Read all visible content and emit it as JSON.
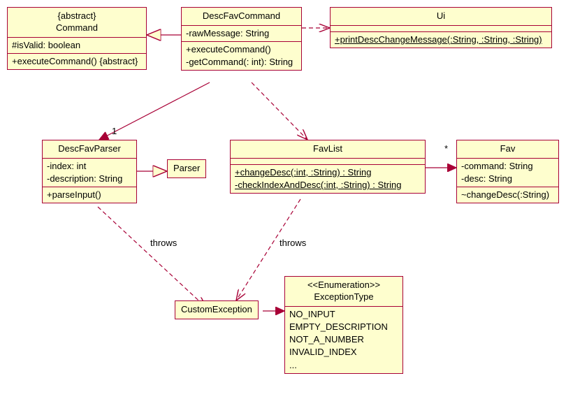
{
  "chart_data": {
    "type": "uml-class-diagram",
    "classes": [
      {
        "name": "Command",
        "stereotype": "{abstract}",
        "attributes": [
          "#isValid: boolean"
        ],
        "operations": [
          "+executeCommand() {abstract}"
        ]
      },
      {
        "name": "DescFavCommand",
        "attributes": [
          "-rawMessage: String"
        ],
        "operations": [
          "+executeCommand()",
          "-getCommand(: int): String"
        ]
      },
      {
        "name": "Ui",
        "operations_static": [
          "+printDescChangeMessage(:String, :String, :String)"
        ]
      },
      {
        "name": "DescFavParser",
        "attributes": [
          "-index: int",
          "-description: String"
        ],
        "operations": [
          "+parseInput()"
        ]
      },
      {
        "name": "Parser"
      },
      {
        "name": "FavList",
        "operations_static": [
          "+changeDesc(:int, :String) : String",
          "-checkIndexAndDesc(:int, :String) : String"
        ]
      },
      {
        "name": "Fav",
        "attributes": [
          "-command: String",
          "-desc: String"
        ],
        "operations": [
          "~changeDesc(:String)"
        ]
      },
      {
        "name": "CustomException"
      },
      {
        "name": "ExceptionType",
        "stereotype": "<<Enumeration>>",
        "literals": [
          "NO_INPUT",
          "EMPTY_DESCRIPTION",
          "NOT_A_NUMBER",
          "INVALID_INDEX",
          "..."
        ]
      }
    ],
    "relationships": [
      {
        "from": "DescFavCommand",
        "to": "Command",
        "type": "generalization"
      },
      {
        "from": "DescFavCommand",
        "to": "Ui",
        "type": "dependency"
      },
      {
        "from": "DescFavCommand",
        "to": "DescFavParser",
        "type": "association",
        "multiplicity_to": "1"
      },
      {
        "from": "DescFavCommand",
        "to": "FavList",
        "type": "dependency"
      },
      {
        "from": "DescFavParser",
        "to": "Parser",
        "type": "generalization"
      },
      {
        "from": "FavList",
        "to": "Fav",
        "type": "association",
        "multiplicity_to": "*"
      },
      {
        "from": "DescFavParser",
        "to": "CustomException",
        "type": "dependency",
        "label": "throws"
      },
      {
        "from": "FavList",
        "to": "CustomException",
        "type": "dependency",
        "label": "throws"
      },
      {
        "from": "CustomException",
        "to": "ExceptionType",
        "type": "association"
      }
    ]
  },
  "labels": {
    "throws1": "throws",
    "throws2": "throws",
    "one": "1",
    "star": "*"
  },
  "boxes": {
    "command": {
      "stereotype": "{abstract}",
      "name": "Command",
      "attr1": "#isValid: boolean",
      "op1": "+executeCommand() {abstract}"
    },
    "descFavCommand": {
      "name": "DescFavCommand",
      "attr1": "-rawMessage: String",
      "op1": "+executeCommand()",
      "op2": "-getCommand(: int): String"
    },
    "ui": {
      "name": "Ui",
      "op1": "+printDescChangeMessage(:String, :String, :String)"
    },
    "descFavParser": {
      "name": "DescFavParser",
      "attr1": "-index: int",
      "attr2": "-description: String",
      "op1": "+parseInput()"
    },
    "parser": {
      "name": "Parser"
    },
    "favList": {
      "name": "FavList",
      "op1": "+changeDesc(:int, :String) : String",
      "op2": "-checkIndexAndDesc(:int, :String) : String"
    },
    "fav": {
      "name": "Fav",
      "attr1": "-command: String",
      "attr2": "-desc: String",
      "op1": "~changeDesc(:String)"
    },
    "customException": {
      "name": "CustomException"
    },
    "exceptionType": {
      "stereotype": "<<Enumeration>>",
      "name": "ExceptionType",
      "l1": "NO_INPUT",
      "l2": "EMPTY_DESCRIPTION",
      "l3": "NOT_A_NUMBER",
      "l4": "INVALID_INDEX",
      "l5": "..."
    }
  }
}
